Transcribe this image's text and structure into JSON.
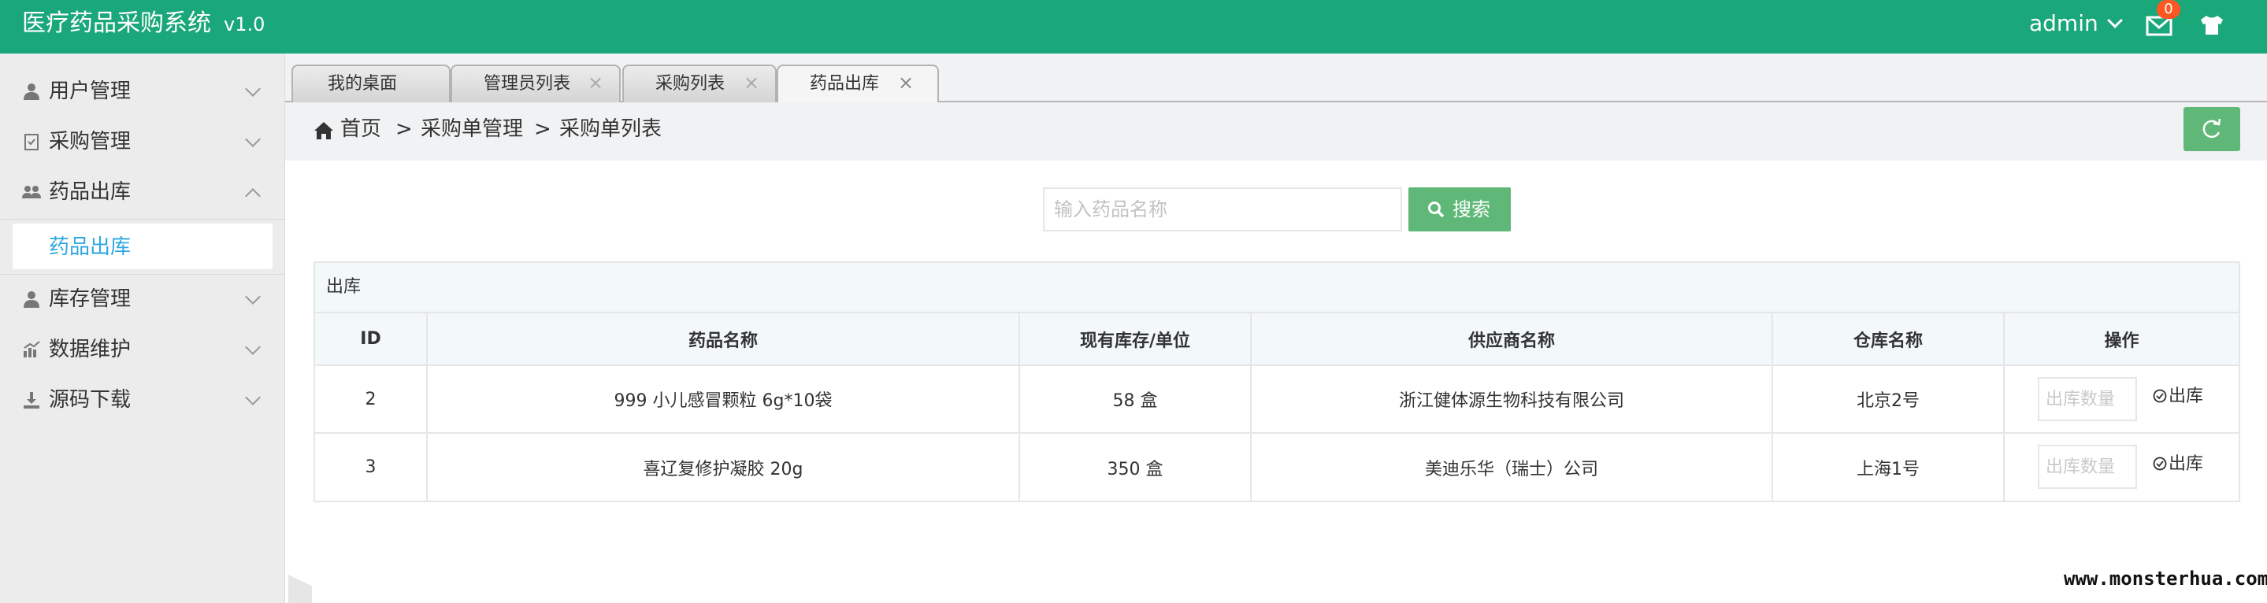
{
  "header": {
    "title": "医疗药品采购系统",
    "version": "v1.0",
    "user": "admin",
    "message_count": "0",
    "icons": {
      "mail": "mail-icon",
      "shirt": "shirt-icon"
    },
    "color": "#1aa77a"
  },
  "sidebar": {
    "items": [
      {
        "label": "用户管理",
        "icon": "user-icon",
        "expanded": false
      },
      {
        "label": "采购管理",
        "icon": "clipboard-icon",
        "expanded": false
      },
      {
        "label": "药品出库",
        "icon": "group-icon",
        "expanded": true,
        "children": [
          {
            "label": "药品出库",
            "active": true
          }
        ]
      },
      {
        "label": "库存管理",
        "icon": "user-icon",
        "expanded": false
      },
      {
        "label": "数据维护",
        "icon": "chart-icon",
        "expanded": false
      },
      {
        "label": "源码下载",
        "icon": "download-icon",
        "expanded": false
      }
    ]
  },
  "tabs": [
    {
      "label": "我的桌面",
      "closable": false
    },
    {
      "label": "管理员列表",
      "closable": true
    },
    {
      "label": "采购列表",
      "closable": true
    },
    {
      "label": "药品出库",
      "closable": true,
      "active": true
    }
  ],
  "breadcrumb": [
    "首页",
    "采购单管理",
    "采购单列表"
  ],
  "breadcrumb_separator": ">",
  "search": {
    "placeholder": "输入药品名称",
    "value": "",
    "button_label": "搜索"
  },
  "panel": {
    "title": "出库",
    "columns": [
      "ID",
      "药品名称",
      "现有库存/单位",
      "供应商名称",
      "仓库名称",
      "操作"
    ],
    "rows": [
      {
        "id": "2",
        "name": "999 小儿感冒颗粒 6g*10袋",
        "stock": "58 盒",
        "supplier": "浙江健体源生物科技有限公司",
        "warehouse": "北京2号"
      },
      {
        "id": "3",
        "name": "喜辽复修护凝胶 20g",
        "stock": "350 盒",
        "supplier": "美迪乐华（瑞士）公司",
        "warehouse": "上海1号"
      }
    ],
    "qty_placeholder": "出库数量",
    "action_label": "出库"
  },
  "watermark": "www.monsterhua.com",
  "colors": {
    "accent_green": "#5fb878",
    "link_blue": "#2ea7e0"
  }
}
